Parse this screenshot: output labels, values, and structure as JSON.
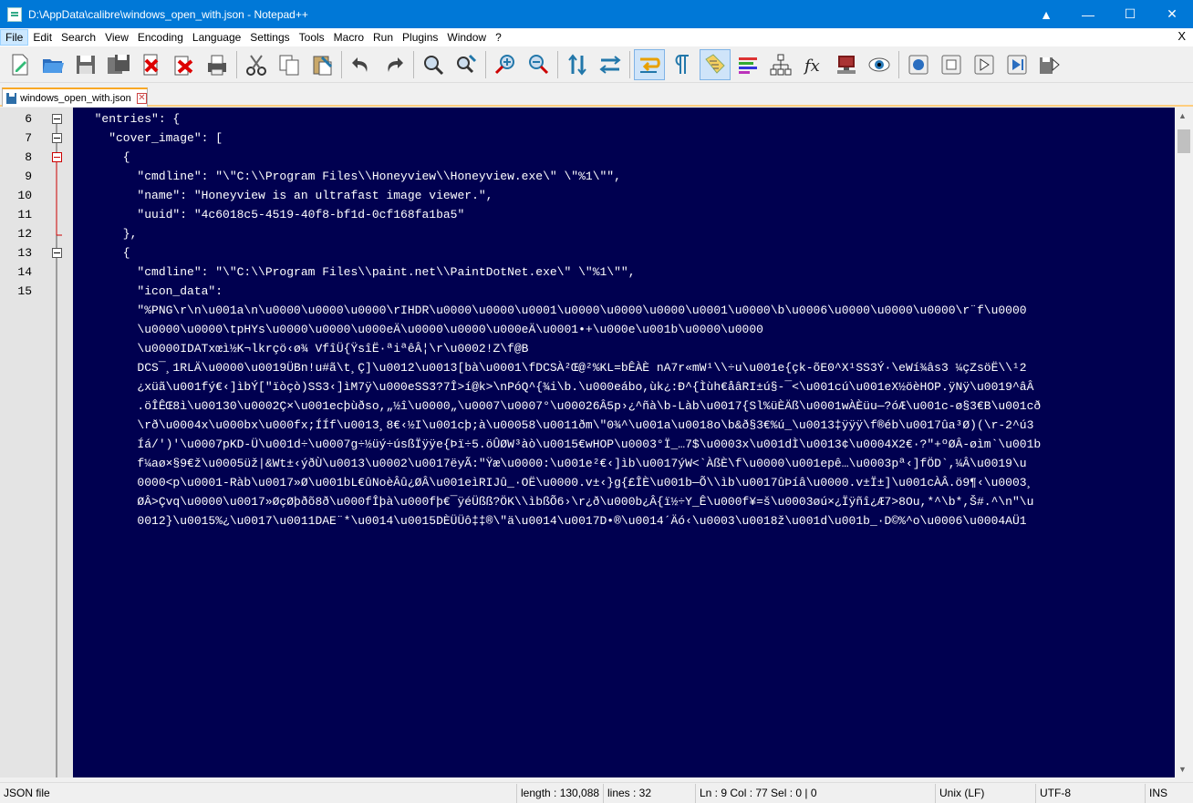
{
  "window": {
    "title": "D:\\AppData\\calibre\\windows_open_with.json - Notepad++"
  },
  "menu": [
    "File",
    "Edit",
    "Search",
    "View",
    "Encoding",
    "Language",
    "Settings",
    "Tools",
    "Macro",
    "Run",
    "Plugins",
    "Window",
    "?"
  ],
  "menu_close": "X",
  "tab": {
    "label": "windows_open_with.json"
  },
  "editor": {
    "line_numbers": [
      "6",
      "7",
      "8",
      "9",
      "10",
      "11",
      "12",
      "13",
      "14",
      "15"
    ],
    "lines": [
      "  \"entries\": {",
      "    \"cover_image\": [",
      "      {",
      "        \"cmdline\": \"\\\"C:\\\\Program Files\\\\Honeyview\\\\Honeyview.exe\\\" \\\"%1\\\"\",",
      "        \"name\": \"Honeyview is an ultrafast image viewer.\",",
      "        \"uuid\": \"4c6018c5-4519-40f8-bf1d-0cf168fa1ba5\"",
      "      },",
      "      {",
      "        \"cmdline\": \"\\\"C:\\\\Program Files\\\\paint.net\\\\PaintDotNet.exe\\\" \\\"%1\\\"\",",
      "        \"icon_data\":",
      "        \"%PNG\\r\\n\\u001a\\n\\u0000\\u0000\\u0000\\rIHDR\\u0000\\u0000\\u0001\\u0000\\u0000\\u0000\\u0001\\u0000\\b\\u0006\\u0000\\u0000\\u0000\\r¨f\\u0000",
      "        \\u0000\\u0000\\tpHYs\\u0000\\u0000\\u000eÄ\\u0000\\u0000\\u000eÄ\\u0001•+\\u000e\\u001b\\u0000\\u0000",
      "        \\u0000IDATxœì½K¬lkrçö‹ø¾ VfîÜ{ŸsîË·ªiªêÂ¦\\r\\u0002!Z\\f@B",
      "        DCS¯¸1RLÄ\\u0000\\u0019ÜBn!u#ã\\t¸Ç]\\u0012\\u0013[bà\\u0001\\fDCSÀ²Œ@²%KL=bÊÀÈ nA7r«mW¹\\\\÷u\\u001e{çk-õE0^X¹SS3Ý·\\eWí¾âs3 ¼çZsöË\\\\¹2",
      "        ¿xüã\\u001fý€‹]ìbÝ[\"ïòçò)SS3‹]ìM7ÿ\\u000eSS3?7Î>í@k>\\nPóQ^{¾i\\b.\\u000eábo,ùk¿:Ð^{Ìùh€åâRI±ú§-¯<\\u001cú\\u001eX½öèHOP.ÿNÿ\\u0019^âÂ",
      "        .öÎÊŒ8ì\\u00130\\u0002Ç×\\u001ecþùðso,„½î\\u0000„\\u0007\\u0007°\\u00026Â5p›¿^ñà\\b-Làb\\u0017{Sl%üÈÄß\\u0001wÀÈüu—?óÆ\\u001c-ø§3€B\\u001cð",
      "        \\rð\\u0004x\\u000bx\\u000fx;ÍÍf\\u0013¸8€‹½I\\u001cþ;à\\u00058\\u0011ðm\\\"0¾^\\u001a\\u0018o\\b&ð§3€%ú_\\u0013‡ÿÿÿ\\f®éb\\u0017ûa³Ø)(\\r-2^ú3",
      "        Íá/')'\\u0007pKD-Ü\\u001d÷\\u0007g÷½üý÷úsßÏÿÿe{Þï÷5.öÛØW³àò\\u0015€wHOP\\u0003°Ï_…7$\\u0003x\\u001dÌ\\u0013¢\\u0004X2€·?\"+ºØÂ-øìm`\\u001b",
      "        f¼aø×§9€ž\\u0005üž|&Wt±‹ýðÙ\\u0013\\u0002\\u0017ëyÃ:\"Ÿæ\\u0000:\\u001e²€‹]ìb\\u0017ýW<`ÀßÈ\\f\\u0000\\u001epê…\\u0003pª‹]fÖD`,¼Â\\u0019\\u",
      "        0000<p\\u0001-Ràb\\u0017»Ø\\u001bL€ûNoèÂû¿ØÂ\\u001eìRIJû_·OË\\u0000.v±‹}g{£ÎÈ\\u001b—Õ\\\\ìb\\u0017ûÞíâ\\u0000.v±Ï±]\\u001cÀÂ.ö9¶‹\\u0003¸",
      "        ØÂ>Çvq\\u0000\\u0017»ØçØþðõ8ð\\u000fÎþà\\u000fþ€¯ÿéÜßß?ÖK\\\\ìbßÕ6›\\r¿ð\\u000b¿Â{ï½÷Y_Ê\\u000f¥=š\\u0003øú×¿Ïÿñî¿Æ7>8Ou,*^\\b*,Š#.^\\n\"\\u",
      "        0012}\\u0015%¿\\u0017\\u0011DAE¨*\\u0014\\u0015DÈÜÜô‡‡®\\\"ä\\u0014\\u0017D•®\\u0014´Äó‹\\u0003\\u0018ž\\u001d\\u001b_·D©%^o\\u0006\\u0004AÜ1"
    ]
  },
  "status": {
    "file_type": "JSON file",
    "length": "length : 130,088",
    "lines": "lines : 32",
    "position": "Ln : 9   Col : 77   Sel : 0 | 0",
    "eol": "Unix (LF)",
    "encoding": "UTF-8",
    "mode": "INS"
  }
}
